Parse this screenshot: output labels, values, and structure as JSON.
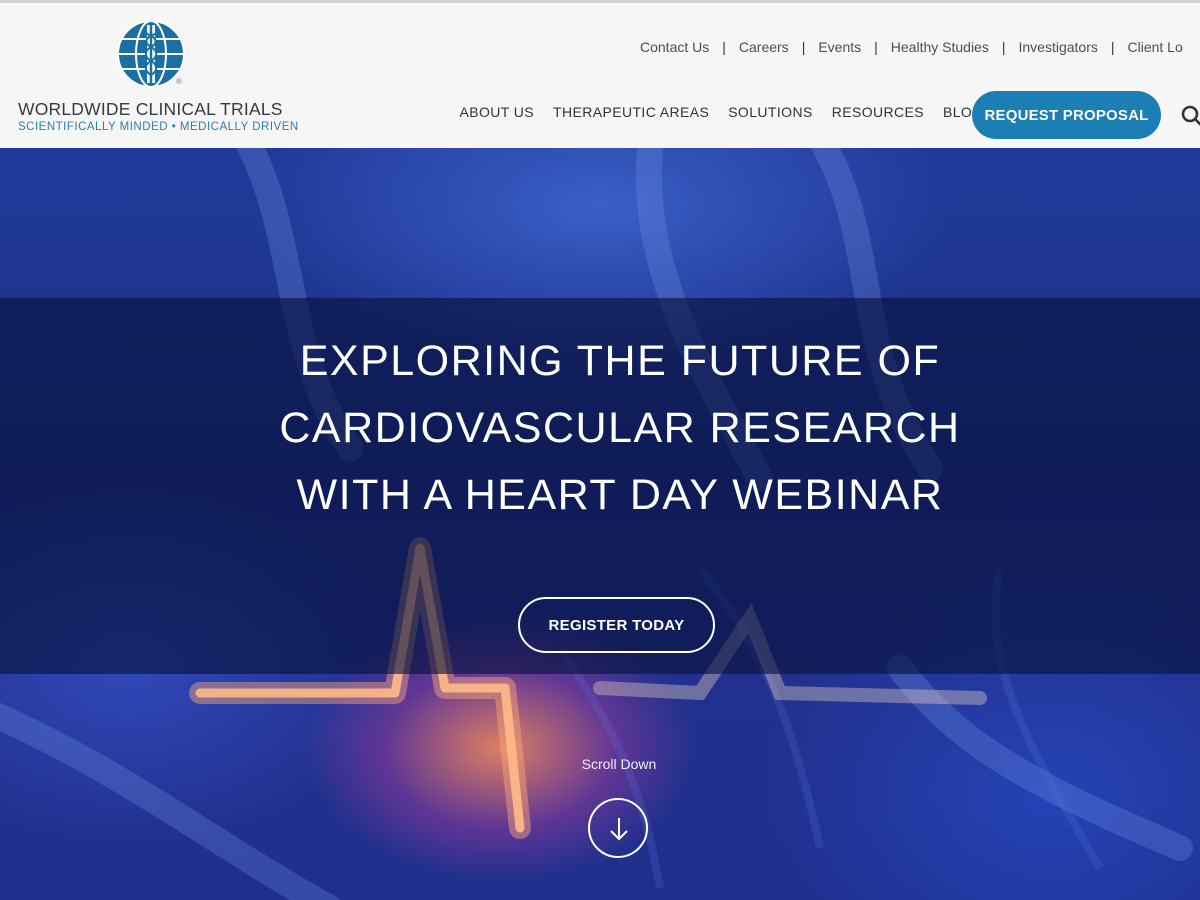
{
  "brand": {
    "name": "WORLDWIDE CLINICAL TRIALS",
    "tagline": "SCIENTIFICALLY MINDED • MEDICALLY DRIVEN",
    "logo_icon": "globe-caduceus-icon",
    "registered_mark": "®"
  },
  "utility_nav": [
    {
      "label": "Contact Us"
    },
    {
      "label": "Careers"
    },
    {
      "label": "Events"
    },
    {
      "label": "Healthy Studies"
    },
    {
      "label": "Investigators"
    },
    {
      "label": "Client Lo"
    }
  ],
  "main_nav": [
    {
      "label": "ABOUT US"
    },
    {
      "label": "THERAPEUTIC AREAS"
    },
    {
      "label": "SOLUTIONS"
    },
    {
      "label": "RESOURCES"
    },
    {
      "label": "BLOG"
    }
  ],
  "cta": {
    "label": "REQUEST PROPOSAL"
  },
  "search": {
    "icon": "search-icon"
  },
  "hero": {
    "title_lines": [
      "EXPLORING THE FUTURE OF",
      "CARDIOVASCULAR RESEARCH",
      "WITH A HEART DAY WEBINAR"
    ],
    "register_label": "REGISTER TODAY",
    "scroll_label": "Scroll Down",
    "scroll_icon": "arrow-down-circle-icon"
  },
  "colors": {
    "brand_blue": "#1b7fb3",
    "tagline_blue": "#2a7fb0",
    "nav_text": "#2f3438",
    "hero_blue": "#1e2f8d"
  }
}
